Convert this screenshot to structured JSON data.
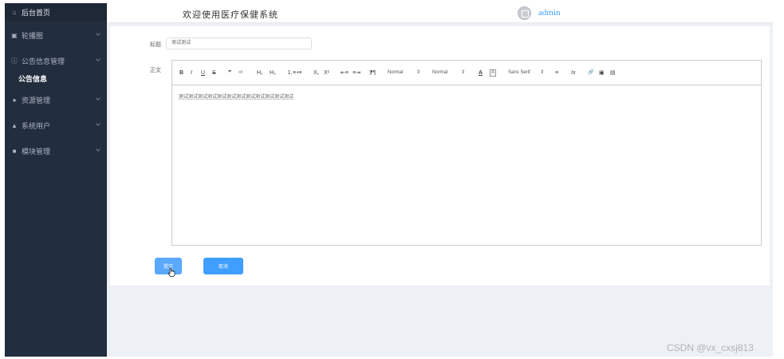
{
  "sidebar": {
    "home": "后台首页",
    "items": [
      {
        "label": "轮播图",
        "icon": "image-icon"
      },
      {
        "label": "公告信息管理",
        "icon": "info-icon"
      },
      {
        "label": "公告信息",
        "icon": ""
      },
      {
        "label": "资源管理",
        "icon": "location-icon"
      },
      {
        "label": "系统用户",
        "icon": "user-icon"
      },
      {
        "label": "模块管理",
        "icon": "grid-icon"
      }
    ]
  },
  "header": {
    "title": "欢迎使用医疗保健系统",
    "username": "admin"
  },
  "form": {
    "title_label": "标题",
    "title_value": "测试测试",
    "body_label": "正文",
    "body_text": "测试测试测试测试测试测试测试测试测试测试测试测试",
    "submit_label": "提交",
    "cancel_label": "取消"
  },
  "toolbar": {
    "bold": "B",
    "italic": "I",
    "underline": "U",
    "strike": "S",
    "quote": "❞",
    "code": "‹/›",
    "h1": "H₁",
    "h2": "H₂",
    "ol": "⒈≡",
    "ul": "•≡",
    "sub": "X₁",
    "sup": "X¹",
    "outdent": "⇤≡",
    "indent": "≡⇥",
    "direction": "⁋¶",
    "size": "Normal",
    "header": "Normal",
    "color": "A",
    "background": "A",
    "font": "Sans Serif",
    "align": "≡",
    "clean": "Ix",
    "link": "🔗",
    "image": "▣",
    "video": "▤",
    "caret": "⇕"
  },
  "watermark": "CSDN @vx_cxsj813"
}
